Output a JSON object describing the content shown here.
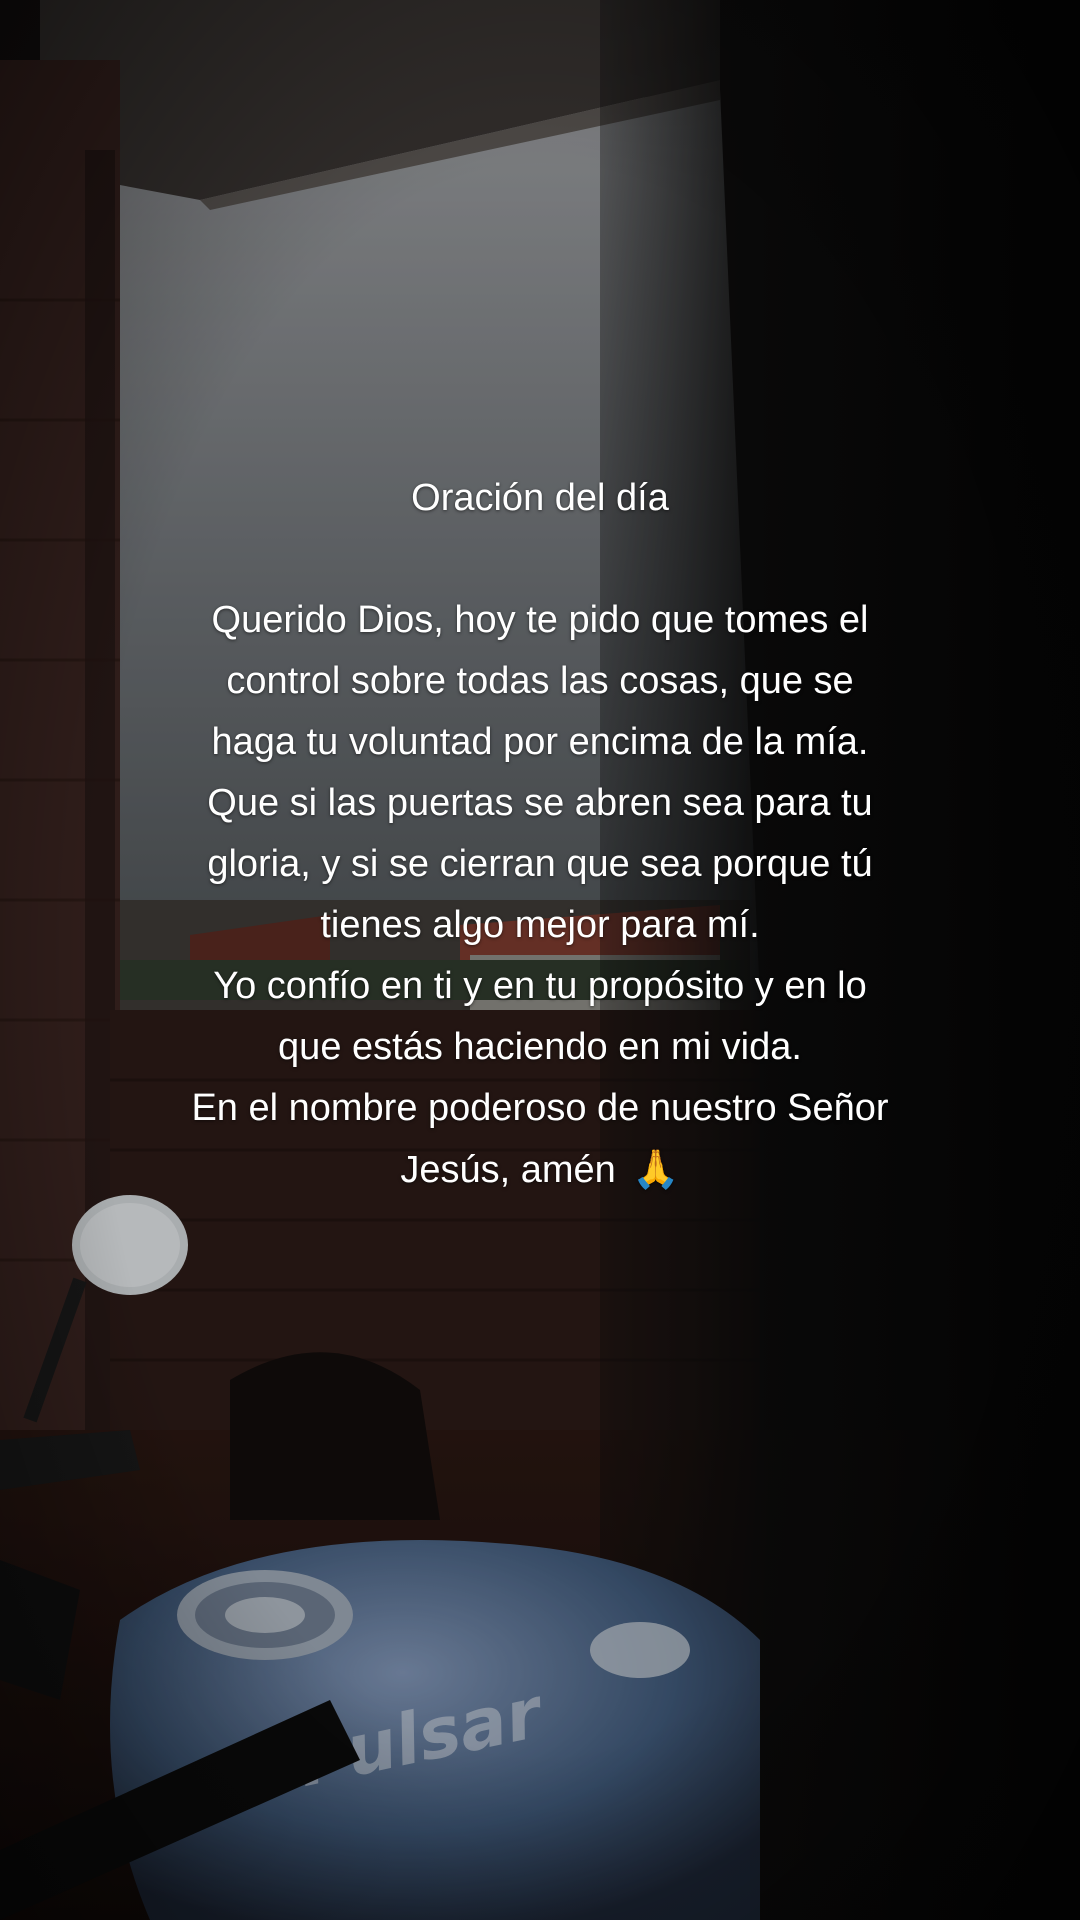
{
  "caption": {
    "title": "Oración del día",
    "lines": [
      "Querido Dios, hoy te pido que tomes el",
      "control sobre todas las cosas, que se",
      "haga tu voluntad por encima de la mía.",
      "Que si las puertas se abren sea para tu",
      "gloria, y si se cierran que sea porque tú",
      "tienes algo mejor para mí.",
      "Yo confío en ti y en tu propósito y en lo",
      "que estás haciendo en mi vida.",
      "En el nombre poderoso de nuestro Señor",
      "Jesús, amén"
    ],
    "emoji": "🙏",
    "emoji_icon": "praying-hands-icon"
  },
  "colors": {
    "text": "#ffffff",
    "sky": "#8f9194",
    "wall": "#3a2420",
    "tank_blue": "#5f7aa0"
  }
}
